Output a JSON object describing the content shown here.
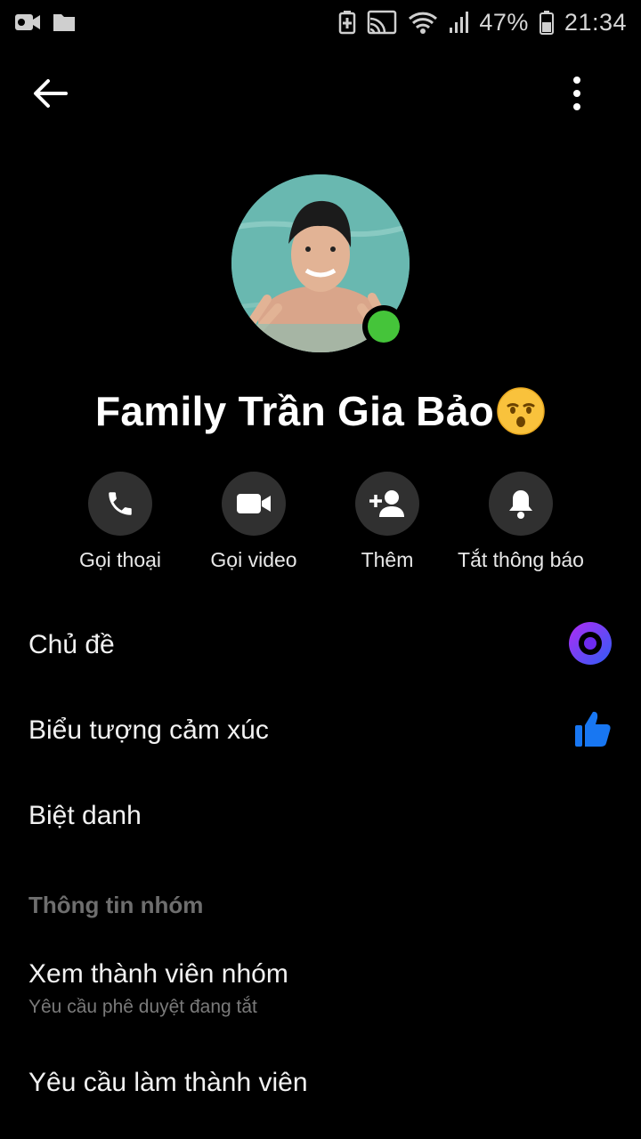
{
  "status_bar": {
    "battery": "47%",
    "time": "21:34"
  },
  "profile": {
    "name": "Family Trần Gia Bảo",
    "emoji": "kissing-face-emoji",
    "online_color": "#45c43a"
  },
  "actions": [
    {
      "label": "Gọi thoại",
      "icon": "phone-icon"
    },
    {
      "label": "Gọi video",
      "icon": "video-camera-icon"
    },
    {
      "label": "Thêm",
      "icon": "add-person-icon"
    },
    {
      "label": "Tắt thông báo",
      "icon": "bell-icon"
    }
  ],
  "settings": {
    "theme_label": "Chủ đề",
    "theme_color": "#7b2ff7",
    "emoji_label": "Biểu tượng cảm xúc",
    "emoji_color": "#1877f2",
    "nickname_label": "Biệt danh"
  },
  "group_info": {
    "header": "Thông tin nhóm",
    "members_label": "Xem thành viên nhóm",
    "members_sub": "Yêu cầu phê duyệt đang tắt",
    "requests_label": "Yêu cầu làm thành viên"
  }
}
